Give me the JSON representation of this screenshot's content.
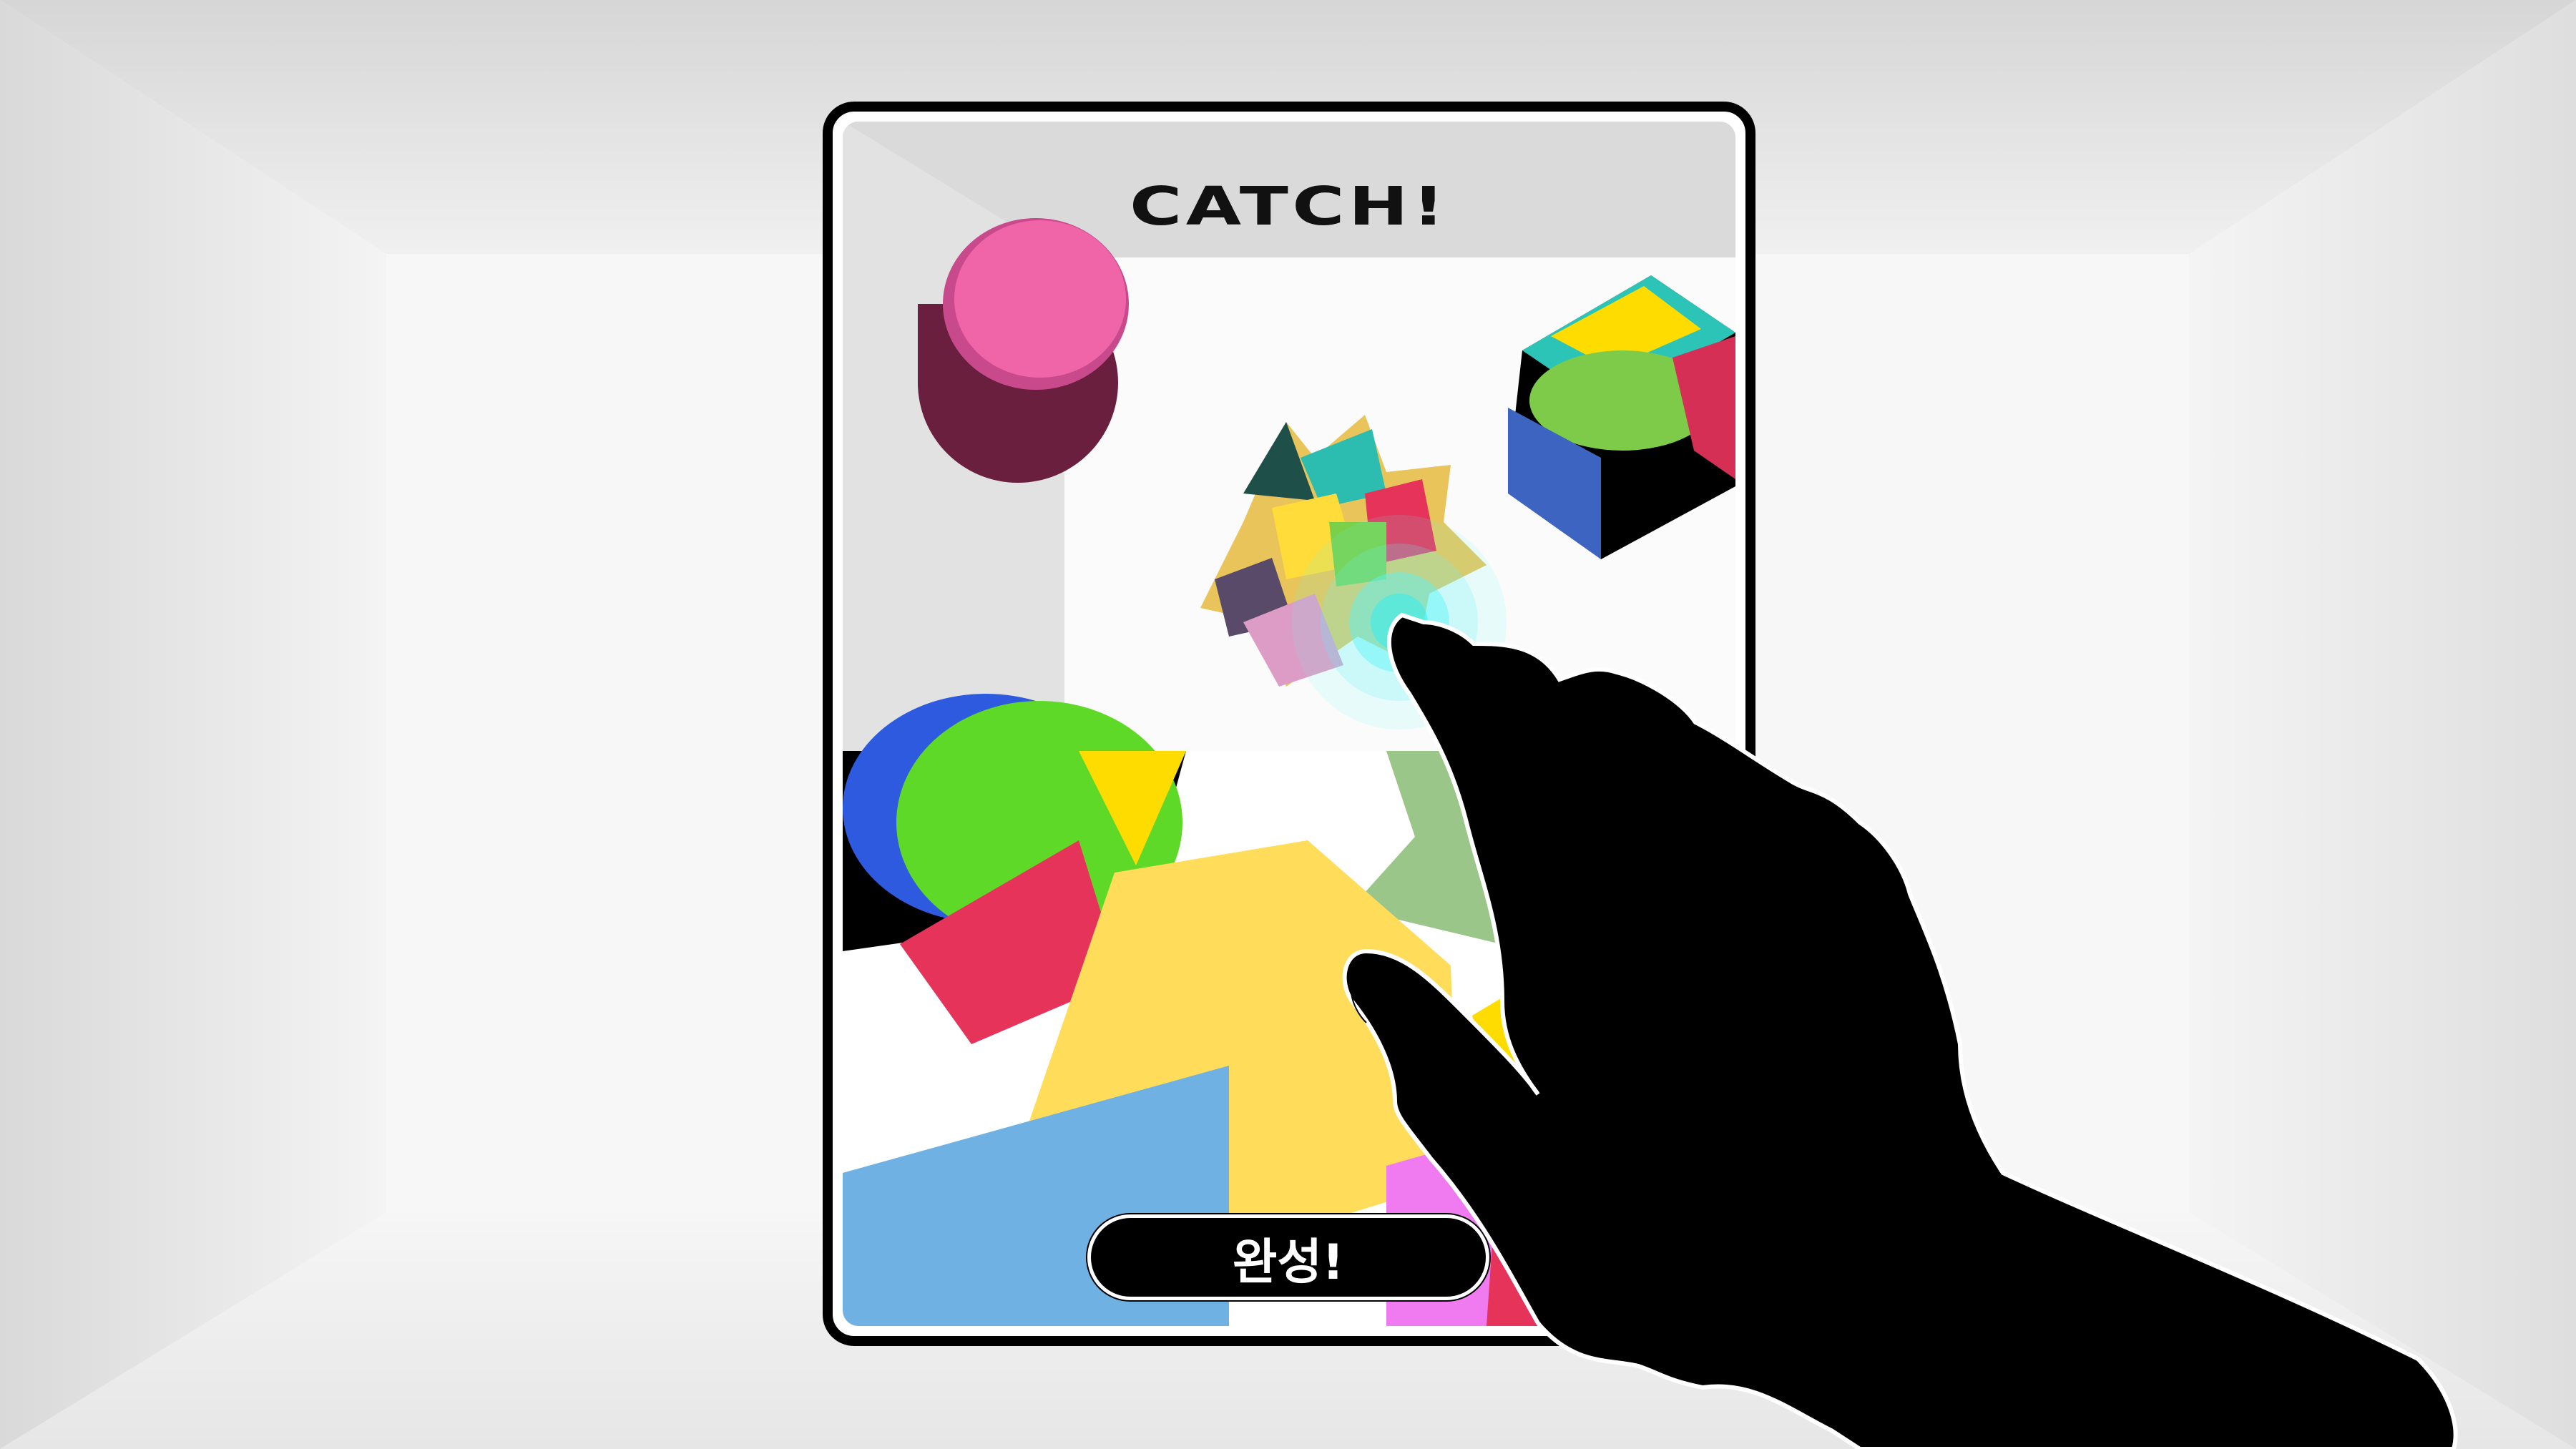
{
  "game": {
    "title": "CATCH!",
    "complete_button_label": "완성!"
  },
  "icons": {
    "pointer": "pointing-hand-icon",
    "tap": "tap-ripple-icon"
  },
  "colors": {
    "pink": "#f064a8",
    "green": "#5fd927",
    "yellow": "#ffdc5a",
    "red": "#e5335a",
    "blue": "#2e5ae0",
    "sky": "#6fb1e3",
    "sage": "#9ac689",
    "cyan": "#5ef5f7",
    "black": "#000000"
  }
}
